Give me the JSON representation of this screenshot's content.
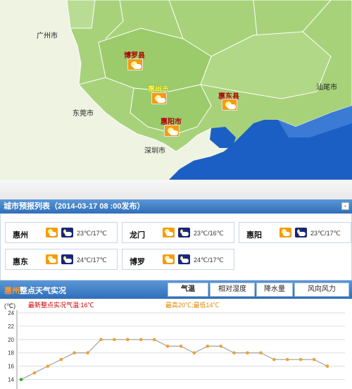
{
  "map": {
    "region_labels": [
      {
        "key": "guangzhou",
        "text": "广州市"
      },
      {
        "key": "dongguan",
        "text": "东莞市"
      },
      {
        "key": "shenzhen",
        "text": "深圳市"
      },
      {
        "key": "shanwei",
        "text": "汕尾市"
      }
    ],
    "cities": [
      {
        "key": "boluo",
        "text": "博罗县",
        "main": false
      },
      {
        "key": "huizhou",
        "text": "惠州市",
        "main": true
      },
      {
        "key": "huidong",
        "text": "惠东县",
        "main": false
      },
      {
        "key": "huiyang",
        "text": "惠阳市",
        "main": false
      }
    ],
    "colors": {
      "land": "#a8d27a",
      "land_dark": "#8fbf63",
      "sea": "#1c5fc4",
      "other": "#eef3e2",
      "border": "#ffffff"
    }
  },
  "city_list": {
    "title": "城市预报列表（2014-03-17 08 :00发布）",
    "collapse_label": "-",
    "cities": [
      {
        "name": "惠州",
        "temp": "23℃/17℃"
      },
      {
        "name": "龙门",
        "temp": "23℃/16℃"
      },
      {
        "name": "惠阳",
        "temp": "23℃/17℃"
      },
      {
        "name": "惠东",
        "temp": "24℃/17℃"
      },
      {
        "name": "博罗",
        "temp": "24℃/17℃"
      }
    ]
  },
  "observation": {
    "city": "惠州",
    "title_rest": "整点天气实况",
    "tabs": [
      "气温",
      "相对湿度",
      "降水量",
      "风向风力"
    ],
    "active_tab": 0
  },
  "chart_data": {
    "type": "line",
    "unit_label": "(℃)",
    "latest_text": "最新整点实况气温:16℃",
    "range_text": "最高20℃;最低14℃",
    "y_ticks": [
      24,
      22,
      20,
      18,
      16,
      14
    ],
    "ylim": [
      13,
      24
    ],
    "series": [
      {
        "values": [
          14,
          15,
          16,
          17,
          18,
          18,
          20,
          20,
          20,
          20,
          20,
          19,
          19,
          18,
          19,
          19,
          18,
          18,
          18,
          17,
          17,
          17,
          17,
          16
        ]
      }
    ],
    "colors": {
      "line": "#a0a0a0",
      "point": "#f0a030",
      "last_point": "#33aa33",
      "latest_text": "#cc0000",
      "range_text": "#dd8800",
      "grid": "#dddddd"
    }
  }
}
